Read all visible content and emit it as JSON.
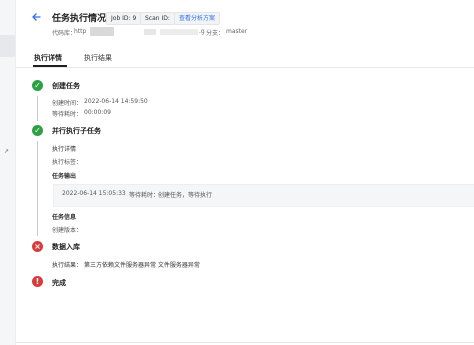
{
  "page": {
    "title": "任务执行情况",
    "tags": [
      "Job ID: 9",
      "Scan ID:",
      "查看分析方案"
    ],
    "repo_label": "代码库：",
    "repo_value": "http",
    "repo_tail": ".g",
    "branch_label": "分支：",
    "branch_value": "master"
  },
  "tabs": [
    {
      "label": "执行详情",
      "active": true
    },
    {
      "label": "执行结果",
      "active": false
    }
  ],
  "steps": {
    "create": {
      "status": "success",
      "title": "创建任务",
      "created_label": "创建时间：",
      "created_value": "2022-06-14 14:59:50",
      "wait_label": "等待耗时：",
      "wait_value": "00:00:09"
    },
    "parallel": {
      "status": "success",
      "title": "并行执行子任务",
      "detail_heading": "执行详情",
      "exec_tag_label": "执行标签：",
      "output_heading": "任务输出",
      "output_time": "2022-06-14 15:05:33",
      "output_wait_label": "等待耗时：",
      "output_message": "创建任务，等待执行",
      "info_heading": "任务信息",
      "create_version_label": "创建版本："
    },
    "ingest": {
      "status": "error",
      "title": "数据入库",
      "result_label": "执行结果：",
      "result_value": "第三方依赖文件服务器异常 文件服务器异常"
    },
    "done": {
      "status": "error",
      "title": "完成"
    }
  },
  "icons": {
    "back": "back-arrow-icon",
    "success": "check-circle-icon",
    "error": "x-circle-icon",
    "warning": "exclamation-circle-icon"
  },
  "colors": {
    "accent": "#2f6fed",
    "success": "#2ea043",
    "error": "#d93b3b"
  }
}
